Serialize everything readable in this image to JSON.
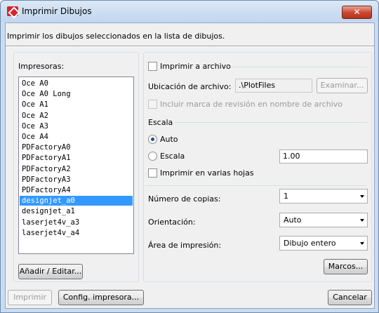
{
  "window": {
    "title": "Imprimir Dibujos",
    "close_label": "✕"
  },
  "intro_text": "Imprimir los dibujos seleccionados en la lista de dibujos.",
  "printers": {
    "label": "Impresoras:",
    "items": [
      "Oce A0",
      "Oce A0 Long",
      "Oce A1",
      "Oce A2",
      "Oce A3",
      "Oce A4",
      "PDFactoryA0",
      "PDFactoryA1",
      "PDFactoryA2",
      "PDFactoryA3",
      "PDFactoryA4",
      "designjet_a0",
      "designjet_a1",
      "laserjet4v_a3",
      "laserjet4v_a4"
    ],
    "selected": "designjet_a0",
    "add_edit_label": "Añadir / Editar..."
  },
  "options": {
    "print_to_file_label": "Imprimir a archivo",
    "print_to_file_checked": false,
    "file_location_label": "Ubicación de archivo:",
    "file_location_value": ".\\PlotFiles",
    "browse_label": "Examinar...",
    "revision_mark_label": "Incluir marca de revisión en nombre de archivo",
    "revision_mark_checked": false,
    "scale_heading": "Escala",
    "auto_label": "Auto",
    "auto_selected": true,
    "scale_label": "Escala",
    "scale_value": "1.00",
    "multi_sheet_label": "Imprimir en varias hojas",
    "multi_sheet_checked": false,
    "copies_label": "Número de copias:",
    "copies_value": "1",
    "orientation_label": "Orientación:",
    "orientation_value": "Auto",
    "print_area_label": "Área de impresión:",
    "print_area_value": "Dibujo entero",
    "frames_label": "Marcos..."
  },
  "footer": {
    "print_label": "Imprimir",
    "printer_config_label": "Config. impresora...",
    "cancel_label": "Cancelar"
  },
  "colors": {
    "selection": "#3399ff",
    "titlebar": "#c9dcf0",
    "close_button": "#c8462e"
  }
}
